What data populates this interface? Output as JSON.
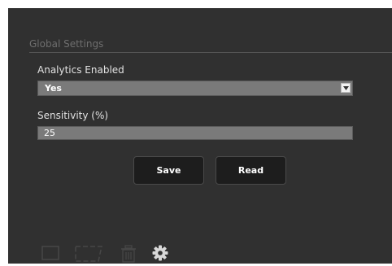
{
  "settings": {
    "section_title": "Global Settings",
    "analytics": {
      "label": "Analytics Enabled",
      "value": "Yes"
    },
    "sensitivity": {
      "label": "Sensitivity (%)",
      "value": "25"
    }
  },
  "buttons": {
    "save_label": "Save",
    "read_label": "Read"
  },
  "toolbar": {
    "icons": [
      "rectangle-icon",
      "polygon-icon",
      "trash-icon",
      "gear-icon"
    ],
    "active": "gear-icon"
  },
  "colors": {
    "panel_bg": "#303030",
    "field_bg": "#7a7a7a",
    "button_bg": "#1d1d1d",
    "icon_dim": "#474747",
    "icon_active": "#d8d8d8"
  }
}
